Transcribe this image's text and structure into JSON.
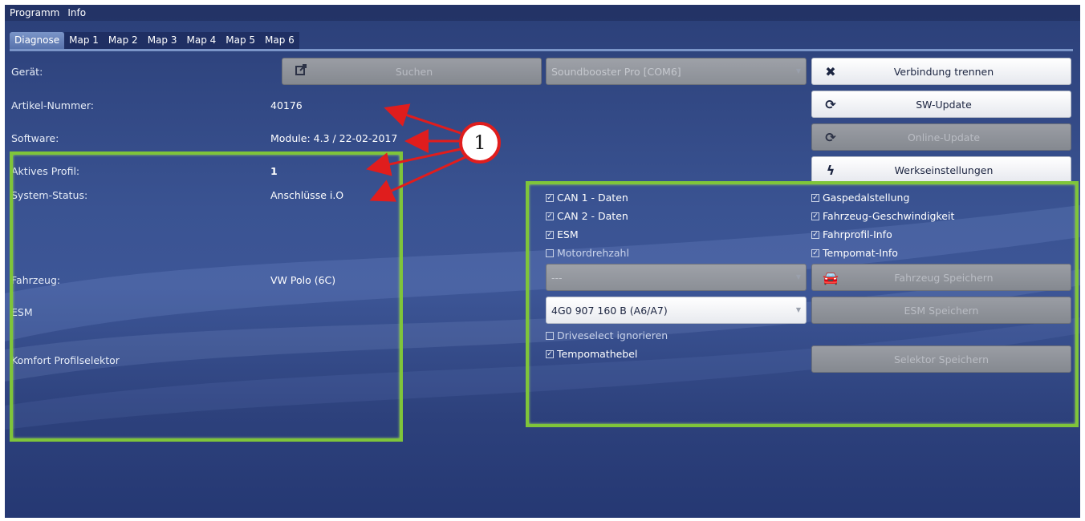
{
  "menu": {
    "items": [
      "Programm",
      "Info"
    ]
  },
  "tabs": [
    "Diagnose",
    "Map 1",
    "Map 2",
    "Map 3",
    "Map 4",
    "Map 5",
    "Map 6"
  ],
  "labels": {
    "geraet": "Gerät:",
    "artikel": "Artikel-Nummer:",
    "software": "Software:",
    "profil": "Aktives Profil:",
    "status": "System-Status:",
    "fahrzeug": "Fahrzeug:",
    "esm": "ESM",
    "komfort": "Komfort Profilselektor"
  },
  "values": {
    "artikel": "40176",
    "software": "Module: 4.3 / 22-02-2017",
    "profil": "1",
    "status": "Anschlüsse i.O",
    "fahrzeug": "VW Polo (6C)"
  },
  "buttons": {
    "suchen": "Suchen",
    "verbindung": "Verbindung trennen",
    "sw_update": "SW-Update",
    "online_update": "Online-Update",
    "werkseinstellungen": "Werkseinstellungen",
    "fahrzeug_speichern": "Fahrzeug Speichern",
    "esm_speichern": "ESM Speichern",
    "selektor_speichern": "Selektor Speichern"
  },
  "selects": {
    "device": "Soundbooster Pro [COM6]",
    "vehicle": "---",
    "esm": "4G0 907 160 B (A6/A7)"
  },
  "checks_left": [
    {
      "label": "CAN 1 - Daten",
      "checked": true
    },
    {
      "label": "CAN 2 - Daten",
      "checked": true
    },
    {
      "label": "ESM",
      "checked": true
    },
    {
      "label": "Motordrehzahl",
      "checked": false
    }
  ],
  "checks_right": [
    {
      "label": "Gaspedalstellung",
      "checked": true
    },
    {
      "label": "Fahrzeug-Geschwindigkeit",
      "checked": true
    },
    {
      "label": "Fahrprofil-Info",
      "checked": true
    },
    {
      "label": "Tempomat-Info",
      "checked": true
    }
  ],
  "checks_extra": [
    {
      "label": "Driveselect ignorieren",
      "checked": false
    },
    {
      "label": "Tempomathebel",
      "checked": true
    }
  ],
  "annotation": {
    "number": "1"
  },
  "colors": {
    "accent_green": "#7fc53a",
    "arrow_red": "#e01d1d",
    "bg_blue": "#3a5392"
  }
}
